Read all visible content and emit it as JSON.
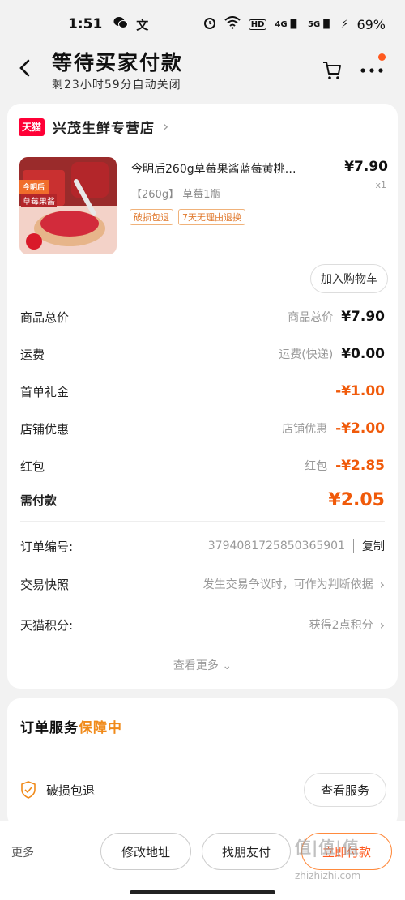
{
  "status": {
    "time": "1:51",
    "left_icons": [
      "wechat-icon",
      "text-icon"
    ],
    "signal_labels": [
      "4G",
      "5G"
    ],
    "battery": "69%",
    "hd_label": "HD"
  },
  "header": {
    "title": "等待买家付款",
    "subtitle": "剩23小时59分自动关闭"
  },
  "shop": {
    "logo_text": "天猫",
    "name": "兴茂生鲜专营店"
  },
  "product": {
    "title": "今明后260g草莓果酱蓝莓黄桃…",
    "price": "¥7.90",
    "qty": "x1",
    "sku": "【260g】 草莓1瓶",
    "tags": [
      "破损包退",
      "7天无理由退换"
    ],
    "image_label": "今明后",
    "image_sub": "草莓果酱",
    "add_cart": "加入购物车"
  },
  "fees": [
    {
      "label": "商品总价",
      "sub": "商品总价",
      "value": "¥7.90",
      "accent": false
    },
    {
      "label": "运费",
      "sub": "运费(快递)",
      "value": "¥0.00",
      "accent": false
    },
    {
      "label": "首单礼金",
      "sub": "",
      "value": "-¥1.00",
      "accent": true
    },
    {
      "label": "店铺优惠",
      "sub": "店铺优惠",
      "value": "-¥2.00",
      "accent": true
    },
    {
      "label": "红包",
      "sub": "红包",
      "value": "-¥2.85",
      "accent": true
    }
  ],
  "total": {
    "label": "需付款",
    "value": "¥2.05"
  },
  "info": {
    "order_no_label": "订单编号:",
    "order_no": "3794081725850365901",
    "copy": "复制",
    "snapshot_label": "交易快照",
    "snapshot_value": "发生交易争议时，可作为判断依据",
    "points_label": "天猫积分:",
    "points_value": "获得2点积分"
  },
  "see_more": "查看更多",
  "service": {
    "title": "订单服务",
    "guard": "保障中",
    "item": "破损包退",
    "view_button": "查看服务"
  },
  "bottom": {
    "more": "更多",
    "modify_address": "修改地址",
    "find_friend": "找朋友付",
    "pay": "立即付款"
  },
  "watermark": {
    "text": "值|值|值",
    "url": "zhizhizhi.com"
  },
  "colors": {
    "accent": "#f05a0a",
    "brand": "#ff0036",
    "guard": "#f08a1a"
  }
}
